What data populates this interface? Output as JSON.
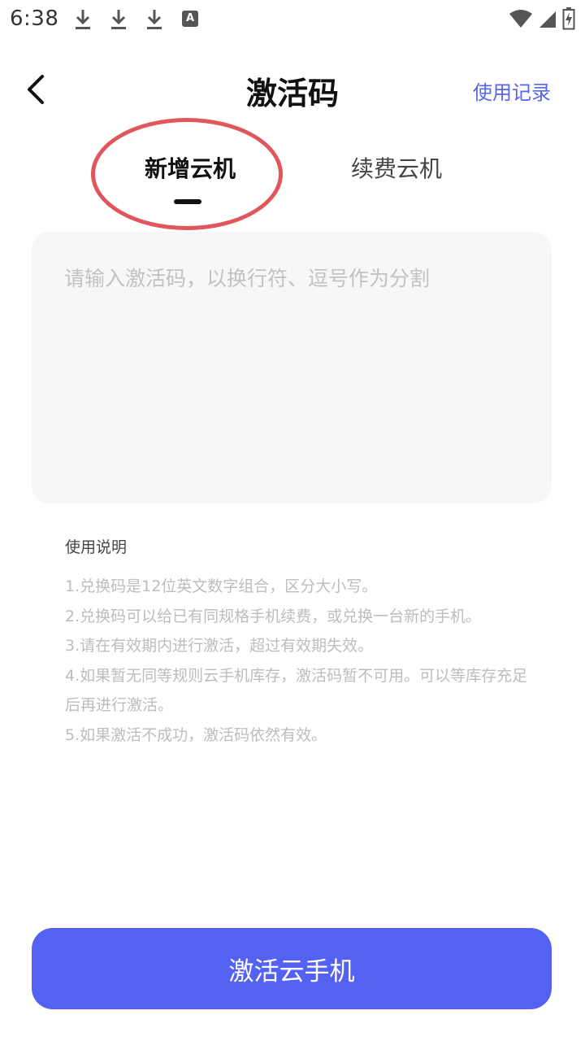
{
  "status_bar": {
    "time": "6:38",
    "icons": [
      "download-icon",
      "download-icon",
      "download-icon",
      "text-icon",
      "wifi-icon",
      "signal-icon",
      "battery-charging-icon"
    ],
    "a_glyph": "A"
  },
  "header": {
    "title": "激活码",
    "history_link": "使用记录",
    "back_icon": "chevron-left-icon"
  },
  "tabs": [
    {
      "label": "新增云机",
      "active": true
    },
    {
      "label": "续费云机",
      "active": false
    }
  ],
  "input": {
    "placeholder": "请输入激活码，以换行符、逗号作为分割",
    "value": ""
  },
  "instructions": {
    "title": "使用说明",
    "items": [
      "1.兑换码是12位英文数字组合，区分大小写。",
      "2.兑换码可以给已有同规格手机续费，或兑换一台新的手机。",
      "3.请在有效期内进行激活，超过有效期失效。",
      "4.如果暂无同等规则云手机库存，激活码暂不可用。可以等库存充足后再进行激活。",
      "5.如果激活不成功，激活码依然有效。"
    ]
  },
  "action_button": {
    "label": "激活云手机"
  },
  "colors": {
    "accent": "#5462f4",
    "link": "#5566f2",
    "annotation": "#e0565a",
    "input_bg": "#f7f7f7"
  }
}
